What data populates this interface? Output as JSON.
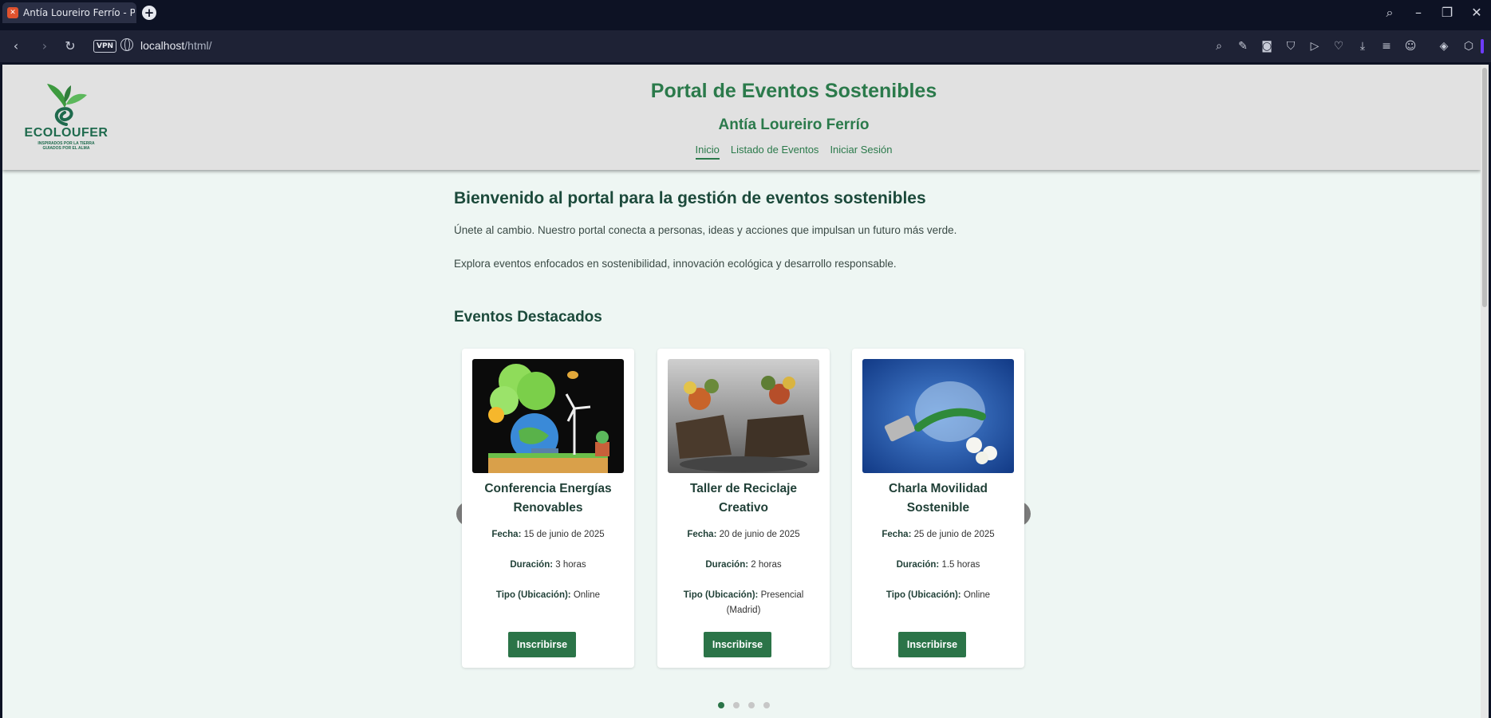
{
  "browser": {
    "tab_title": "Antía Loureiro Ferrío - Por",
    "url_host": "localhost",
    "url_path": "/html/",
    "vpn_label": "VPN"
  },
  "header": {
    "logo_text": "ECOLOUFER",
    "logo_tagline_1": "INSPIRADOS POR LA TIERRA",
    "logo_tagline_2": "GUIADOS POR EL ALMA",
    "title": "Portal de Eventos Sostenibles",
    "subtitle": "Antía Loureiro Ferrío",
    "nav": [
      "Inicio",
      "Listado de Eventos",
      "Iniciar Sesión"
    ]
  },
  "main": {
    "heading": "Bienvenido al portal para la gestión de eventos sostenibles",
    "intro_1": "Únete al cambio. Nuestro portal conecta a personas, ideas y acciones que impulsan un futuro más verde.",
    "intro_2": "Explora eventos enfocados en sostenibilidad, innovación ecológica y desarrollo responsable.",
    "featured_heading": "Eventos Destacados"
  },
  "labels": {
    "date": "Fecha:",
    "duration": "Duración:",
    "type": "Tipo (Ubicación):",
    "button": "Inscribirse"
  },
  "events": [
    {
      "title": "Conferencia Energías Renovables",
      "date": "15 de junio de 2025",
      "duration": "3 horas",
      "type": "Online"
    },
    {
      "title": "Taller de Reciclaje Creativo",
      "date": "20 de junio de 2025",
      "duration": "2 horas",
      "type": "Presencial (Madrid)"
    },
    {
      "title": "Charla Movilidad Sostenible",
      "date": "25 de junio de 2025",
      "duration": "1.5 horas",
      "type": "Online"
    }
  ],
  "carousel": {
    "prev": "❮",
    "next": "❯",
    "pages": 4,
    "active_page": 1
  }
}
